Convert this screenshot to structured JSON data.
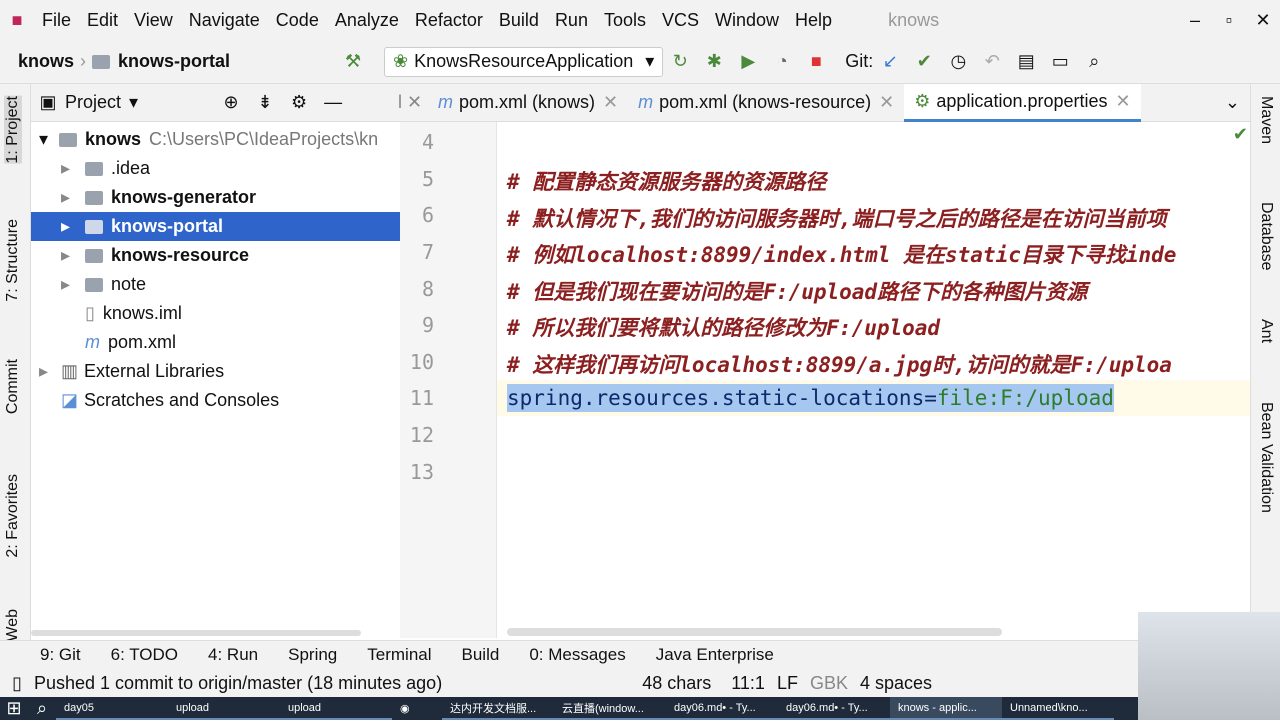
{
  "menu": [
    "File",
    "Edit",
    "View",
    "Navigate",
    "Code",
    "Analyze",
    "Refactor",
    "Build",
    "Run",
    "Tools",
    "VCS",
    "Window",
    "Help"
  ],
  "window_title": "knows",
  "breadcrumb": [
    "knows",
    "knows-portal"
  ],
  "run_config": "KnowsResourceApplication",
  "git_label": "Git:",
  "project_panel": {
    "title": "Project",
    "items": [
      {
        "label": "knows",
        "path": "C:\\Users\\PC\\IdeaProjects\\kn"
      },
      {
        "label": ".idea"
      },
      {
        "label": "knows-generator"
      },
      {
        "label": "knows-portal"
      },
      {
        "label": "knows-resource"
      },
      {
        "label": "note"
      },
      {
        "label": "knows.iml"
      },
      {
        "label": "pom.xml"
      },
      {
        "label": "External Libraries"
      },
      {
        "label": "Scratches and Consoles"
      }
    ]
  },
  "tabs": [
    "pom.xml (knows)",
    "pom.xml (knows-resource)",
    "application.properties"
  ],
  "left_stripe": [
    "1: Project",
    "7: Structure",
    "Commit",
    "2: Favorites",
    "Web"
  ],
  "right_stripe": [
    "Maven",
    "Database",
    "Ant",
    "Bean Validation"
  ],
  "editor": {
    "line_numbers": [
      "4",
      "5",
      "6",
      "7",
      "8",
      "9",
      "10",
      "11",
      "12",
      "13"
    ],
    "lines": [
      "",
      "#  配置静态资源服务器的资源路径",
      "#  默认情况下,我们的访问服务器时,端口号之后的路径是在访问当前项",
      "#  例如localhost:8899/index.html  是在static目录下寻找inde",
      "#  但是我们现在要访问的是F:/upload路径下的各种图片资源",
      "#  所以我们要将默认的路径修改为F:/upload",
      "#  这样我们再访问localhost:8899/a.jpg时,访问的就是F:/uploa",
      "",
      "",
      ""
    ],
    "key": "spring.resources.static-locations=",
    "value": "file:F:/upload"
  },
  "tool_windows": [
    "9: Git",
    "6: TODO",
    "4: Run",
    "Spring",
    "Terminal",
    "Build",
    "0: Messages",
    "Java Enterprise"
  ],
  "status": {
    "message": "Pushed 1 commit to origin/master (18 minutes ago)",
    "chars": "48 chars",
    "pos": "11:1",
    "eol": "LF",
    "encoding": "GBK",
    "indent": "4 spaces"
  },
  "taskbar": [
    "day05",
    "upload",
    "upload",
    "达内开发文档服...",
    "云直播(window...",
    "day06.md• - Ty...",
    "day06.md• - Ty...",
    "knows - applic...",
    "Unnamed\\kno..."
  ]
}
